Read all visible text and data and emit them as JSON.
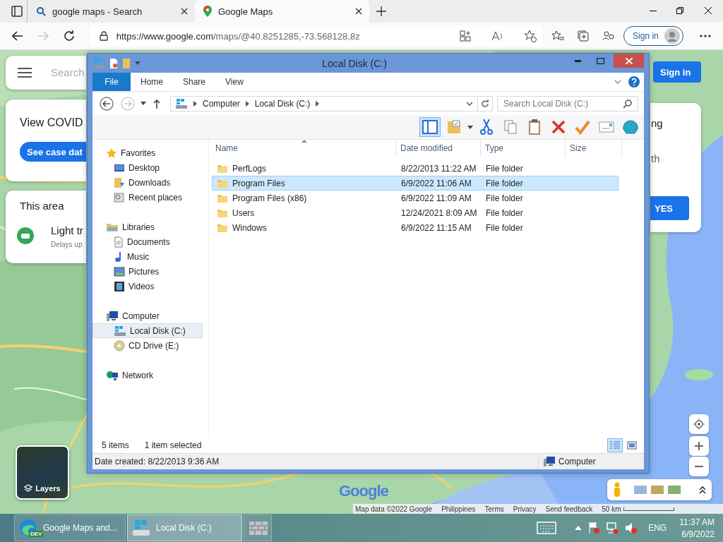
{
  "browser": {
    "tabs": [
      {
        "title": "google maps - Search",
        "kind": "search",
        "selected": false
      },
      {
        "title": "Google Maps",
        "kind": "maps",
        "selected": true
      }
    ],
    "url_host": "https://www.google.com",
    "url_path": "/maps/@40.8251285,-73.568128,8z",
    "forward_disabled": true,
    "sign_in": "Sign in"
  },
  "maps": {
    "search_placeholder": "Search",
    "covid_title": "View COVID",
    "covid_button": "See case dat",
    "area_title": "This area",
    "traffic_title": "Light tr",
    "traffic_subtitle": "Delays up",
    "prompt_line_1": "ng",
    "prompt_line_2": "th",
    "yes_button": "YES",
    "sign_in": "Sign in",
    "layers": "Layers",
    "logo": "Google",
    "footer": [
      "Map data ©2022 Google",
      "Philippines",
      "Terms",
      "Privacy",
      "Send feedback"
    ],
    "scale": "50 km"
  },
  "explorer": {
    "title": "Local Disk (C:)",
    "file_tab": "File",
    "ribbon_tabs": [
      "Home",
      "Share",
      "View"
    ],
    "forward_disabled": true,
    "breadcrumb": [
      "Computer",
      "Local Disk (C:)"
    ],
    "search_placeholder": "Search Local Disk (C:)",
    "toolbar": [
      {
        "kind": "pane",
        "selected": true
      },
      {
        "kind": "properties",
        "selected": false
      },
      {
        "kind": "cut",
        "selected": false
      },
      {
        "kind": "copy",
        "selected": false
      },
      {
        "kind": "paste",
        "selected": false
      },
      {
        "kind": "delete",
        "selected": false
      },
      {
        "kind": "check",
        "selected": false
      },
      {
        "kind": "rename",
        "selected": false
      },
      {
        "kind": "shell",
        "selected": false
      }
    ],
    "nav": [
      {
        "label": "Favorites",
        "kind": "star",
        "selected": false,
        "children": [
          {
            "label": "Desktop",
            "kind": "desktop",
            "selected": false
          },
          {
            "label": "Downloads",
            "kind": "downloads",
            "selected": false
          },
          {
            "label": "Recent places",
            "kind": "recent",
            "selected": false
          }
        ]
      },
      {
        "label": "Libraries",
        "kind": "library",
        "selected": false,
        "children": [
          {
            "label": "Documents",
            "kind": "documents",
            "selected": false
          },
          {
            "label": "Music",
            "kind": "music",
            "selected": false
          },
          {
            "label": "Pictures",
            "kind": "pictures",
            "selected": false
          },
          {
            "label": "Videos",
            "kind": "videos",
            "selected": false
          }
        ]
      },
      {
        "label": "Computer",
        "kind": "computer",
        "selected": false,
        "children": [
          {
            "label": "Local Disk (C:)",
            "kind": "disk",
            "selected": true
          },
          {
            "label": "CD Drive (E:)",
            "kind": "cd",
            "selected": false
          }
        ]
      },
      {
        "label": "Network",
        "kind": "network",
        "selected": false
      }
    ],
    "columns": [
      "Name",
      "Date modified",
      "Type",
      "Size"
    ],
    "rows": [
      {
        "name": "PerfLogs",
        "date": "8/22/2013 11:22 AM",
        "type": "File folder",
        "selected": false
      },
      {
        "name": "Program Files",
        "date": "6/9/2022 11:06 AM",
        "type": "File folder",
        "selected": true
      },
      {
        "name": "Program Files (x86)",
        "date": "6/9/2022 11:09 AM",
        "type": "File folder",
        "selected": false
      },
      {
        "name": "Users",
        "date": "12/24/2021 8:09 AM",
        "type": "File folder",
        "selected": false
      },
      {
        "name": "Windows",
        "date": "6/9/2022 11:15 AM",
        "type": "File folder",
        "selected": false
      }
    ],
    "item_count": "5 items",
    "selection_count": "1 item selected",
    "views": [
      {
        "kind": "details",
        "selected": true
      },
      {
        "kind": "tiles",
        "selected": false
      }
    ],
    "details": "Date created: 8/22/2013 9:36 AM",
    "location": "Computer"
  },
  "taskbar": {
    "items": [
      {
        "label": "Google Maps and...",
        "kind": "edge",
        "badge": "DEV",
        "selected": false
      },
      {
        "label": "Local Disk (C:)",
        "kind": "explorer",
        "selected": true
      },
      {
        "kind": "firewall",
        "selected": false
      }
    ],
    "language": "ENG",
    "time": "11:37 AM",
    "date": "6/9/2022"
  }
}
